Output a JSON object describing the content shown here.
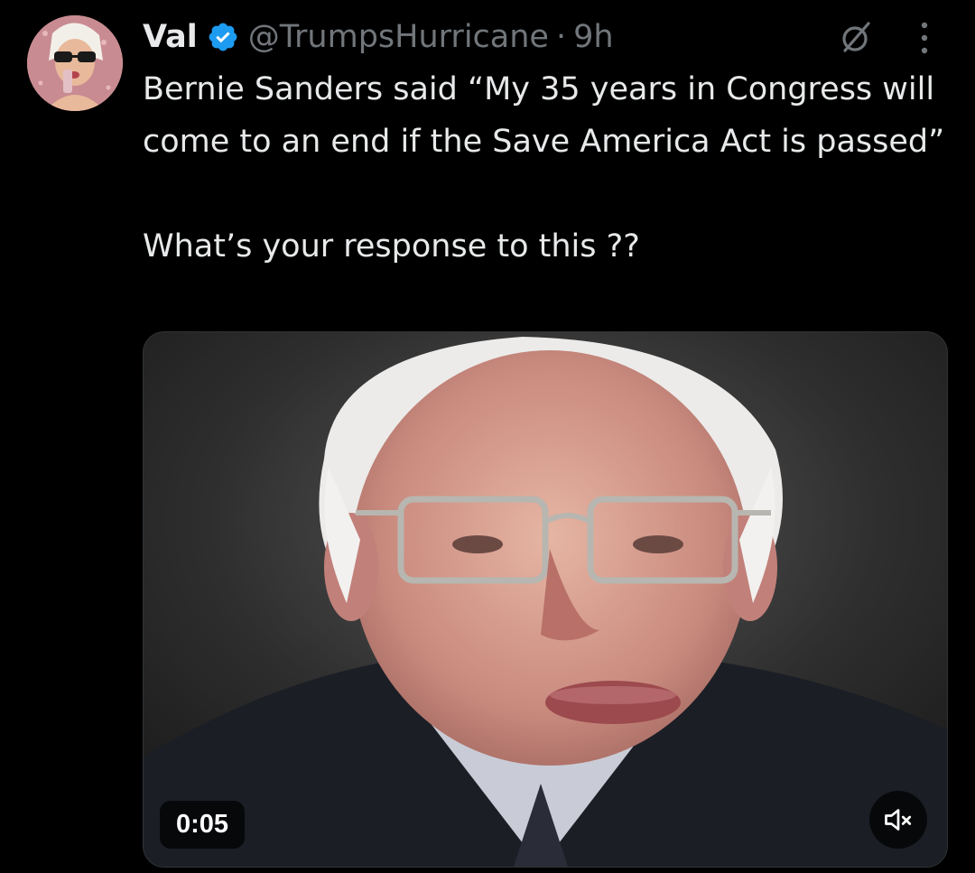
{
  "post": {
    "author_name": "Val",
    "handle": "@TrumpsHurricane",
    "separator": "·",
    "time": "9h",
    "text_line_1": "Bernie Sanders said “My 35 years in Congress will come to an end if the Save America Act is passed”",
    "text_line_2": "What’s your response to this ??"
  },
  "media": {
    "duration": "0:05"
  },
  "icons": {
    "verified": "verified-badge-icon",
    "grok": "grok-icon",
    "more": "more-vertical-icon",
    "mute": "speaker-muted-icon"
  },
  "colors": {
    "background": "#000000",
    "text": "#e7e9ea",
    "secondary_text": "#71767b",
    "verified_blue": "#1d9bf0"
  }
}
